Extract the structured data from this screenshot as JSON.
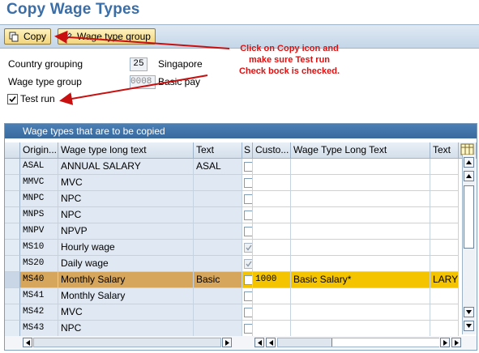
{
  "window": {
    "title": "Copy Wage Types"
  },
  "toolbar": {
    "copy_label": "Copy",
    "wagetype_group_label": "Wage type group"
  },
  "annotation": {
    "lines": [
      "Click on Copy icon and",
      "make sure  Test run",
      "Check bock is checked."
    ]
  },
  "form": {
    "country_grouping_label": "Country grouping",
    "country_grouping_value": "25",
    "country_grouping_text": "Singapore",
    "wage_type_group_label": "Wage type group",
    "wage_type_group_value": "0008",
    "wage_type_group_text": "Basic pay",
    "test_run_label": "Test run",
    "test_run_checked": true
  },
  "table": {
    "title": "Wage types that are to be copied",
    "columns": [
      "Origin...",
      "Wage type long text",
      "Text",
      "S",
      "Custo...",
      "Wage Type Long Text",
      "Text"
    ],
    "rows": [
      {
        "origin": "ASAL",
        "long_text": "ANNUAL SALARY",
        "text": "ASAL",
        "s": "",
        "custom": "",
        "new_long_text": "",
        "new_text": ""
      },
      {
        "origin": "MMVC",
        "long_text": "MVC",
        "text": "",
        "s": "",
        "custom": "",
        "new_long_text": "",
        "new_text": ""
      },
      {
        "origin": "MNPC",
        "long_text": "NPC",
        "text": "",
        "s": "",
        "custom": "",
        "new_long_text": "",
        "new_text": ""
      },
      {
        "origin": "MNPS",
        "long_text": "NPC",
        "text": "",
        "s": "",
        "custom": "",
        "new_long_text": "",
        "new_text": ""
      },
      {
        "origin": "MNPV",
        "long_text": "NPVP",
        "text": "",
        "s": "",
        "custom": "",
        "new_long_text": "",
        "new_text": ""
      },
      {
        "origin": "MS10",
        "long_text": "Hourly wage",
        "text": "",
        "s": "checked",
        "custom": "",
        "new_long_text": "",
        "new_text": ""
      },
      {
        "origin": "MS20",
        "long_text": "Daily wage",
        "text": "",
        "s": "checked",
        "custom": "",
        "new_long_text": "",
        "new_text": ""
      },
      {
        "origin": "MS40",
        "long_text": "Monthly Salary",
        "text": "Basic",
        "s": "",
        "custom": "1000",
        "new_long_text": "Basic Salary*",
        "new_text": "LARY"
      },
      {
        "origin": "MS41",
        "long_text": "Monthly Salary",
        "text": "",
        "s": "",
        "custom": "",
        "new_long_text": "",
        "new_text": ""
      },
      {
        "origin": "MS42",
        "long_text": "MVC",
        "text": "",
        "s": "",
        "custom": "",
        "new_long_text": "",
        "new_text": ""
      },
      {
        "origin": "MS43",
        "long_text": "NPC",
        "text": "",
        "s": "",
        "custom": "",
        "new_long_text": "",
        "new_text": ""
      }
    ]
  },
  "colors": {
    "title": "#3a6ea8",
    "annotation": "#e01010",
    "selected_row": "#f5c400"
  }
}
